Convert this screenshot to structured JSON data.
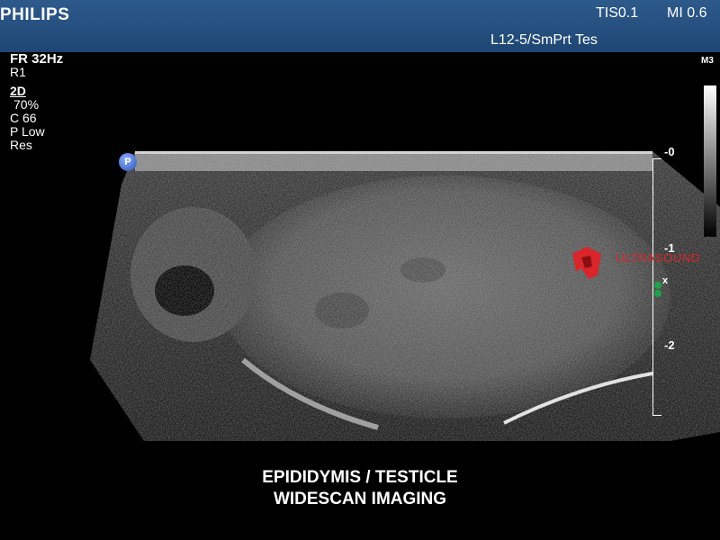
{
  "header": {
    "brand": "PHILIPS",
    "tis": "TIS0.1",
    "mi": "MI 0.6",
    "probe": "L12-5/SmPrt Tes"
  },
  "params": {
    "frame_rate": "FR 32Hz",
    "r": "R1",
    "mode": "2D",
    "gain": "70%",
    "compression": "C 66",
    "persistence": "P Low",
    "resolution": "Res"
  },
  "map_label": "M3",
  "depth_scale": [
    "0",
    "1",
    "2"
  ],
  "depth_scale_prefix": "-",
  "marker": {
    "p_label": "P",
    "x_label": "x"
  },
  "watermark": {
    "text": "ULTRASOUND",
    "color": "#d8262b"
  },
  "caption": {
    "line1": "EPIDIDYMIS / TESTICLE",
    "line2": "WIDESCAN  IMAGING"
  },
  "colors": {
    "header_bg": "#2d5a8c",
    "marker_green": "#1fa34a",
    "probe_blue": "#2a4fb4"
  }
}
